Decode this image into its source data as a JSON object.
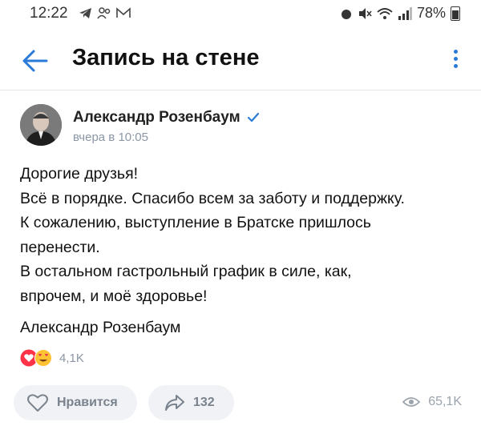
{
  "status_bar": {
    "time": "12:22",
    "battery": "78%"
  },
  "header": {
    "title": "Запись на стене"
  },
  "post": {
    "author": "Александр Розенбаум",
    "time": "вчера в 10:05",
    "lines": [
      "Дорогие друзья!",
      "Всё в порядке. Спасибо всем за заботу и поддержку.",
      "К сожалению, выступление в Братске пришлось",
      "перенести.",
      "В остальном гастрольный график в силе, как,",
      "впрочем, и моё здоровье!"
    ],
    "signature": "Александр Розенбаум",
    "reactions_count": "4,1K"
  },
  "actions": {
    "like_label": "Нравится",
    "share_count": "132",
    "views_count": "65,1K"
  },
  "colors": {
    "accent": "#2a7bd8",
    "muted": "#8a96a4",
    "button_bg": "#f0f2f5"
  },
  "icons": [
    "back-arrow-icon",
    "more-vertical-icon",
    "verified-icon",
    "heart-reaction-icon",
    "love-eyes-reaction-icon",
    "like-outline-icon",
    "share-arrow-icon",
    "eye-icon"
  ]
}
